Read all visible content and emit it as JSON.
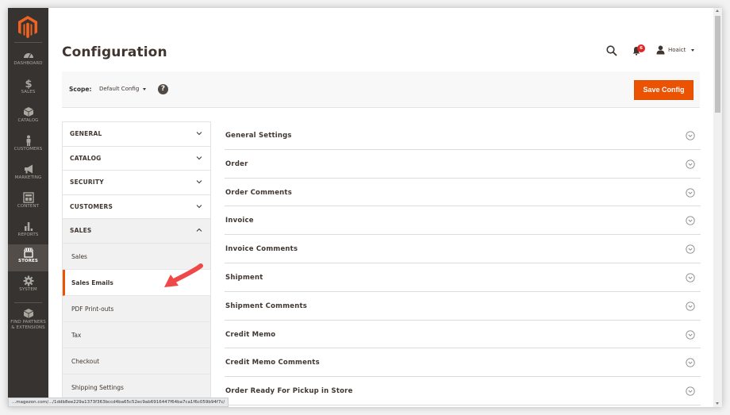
{
  "sidebar": {
    "logo": "magento-logo",
    "items": [
      {
        "label": "DASHBOARD",
        "icon": "dashboard-icon",
        "active": false
      },
      {
        "label": "SALES",
        "icon": "dollar-icon",
        "active": false
      },
      {
        "label": "CATALOG",
        "icon": "box-icon",
        "active": false
      },
      {
        "label": "CUSTOMERS",
        "icon": "person-icon",
        "active": false
      },
      {
        "label": "MARKETING",
        "icon": "megaphone-icon",
        "active": false
      },
      {
        "label": "CONTENT",
        "icon": "layout-icon",
        "active": false
      },
      {
        "label": "REPORTS",
        "icon": "bar-chart-icon",
        "active": false
      },
      {
        "label": "STORES",
        "icon": "storefront-icon",
        "active": true
      },
      {
        "label": "SYSTEM",
        "icon": "gear-icon",
        "active": false
      },
      {
        "label": "FIND PARTNERS",
        "label2": "& EXTENSIONS",
        "icon": "puzzle-cube-icon",
        "active": false
      }
    ]
  },
  "header": {
    "title": "Configuration",
    "notifications_count": "6",
    "user_name": "Hoaict"
  },
  "scope": {
    "label": "Scope:",
    "value": "Default Config",
    "help": "?",
    "save_label": "Save Config"
  },
  "tabs": [
    {
      "label": "GENERAL",
      "open": false
    },
    {
      "label": "CATALOG",
      "open": false
    },
    {
      "label": "SECURITY",
      "open": false
    },
    {
      "label": "CUSTOMERS",
      "open": false
    },
    {
      "label": "SALES",
      "open": true
    }
  ],
  "sales_items": [
    {
      "label": "Sales",
      "active": false
    },
    {
      "label": "Sales Emails",
      "active": true
    },
    {
      "label": "PDF Print-outs",
      "active": false
    },
    {
      "label": "Tax",
      "active": false
    },
    {
      "label": "Checkout",
      "active": false
    },
    {
      "label": "Shipping Settings",
      "active": false
    }
  ],
  "sections": [
    "General Settings",
    "Order",
    "Order Comments",
    "Invoice",
    "Invoice Comments",
    "Shipment",
    "Shipment Comments",
    "Credit Memo",
    "Credit Memo Comments",
    "Order Ready For Pickup in Store"
  ],
  "status_url": "...magezon.com/.../1ddb8ee229a1373f363bccd4ba65c52ec9ab6916447f64ba7ca1f6c059b94f7c/",
  "colors": {
    "accent": "#eb5202",
    "sidebar_bg": "#373330",
    "badge": "#e22626",
    "annotation_arrow": "#f04848"
  }
}
